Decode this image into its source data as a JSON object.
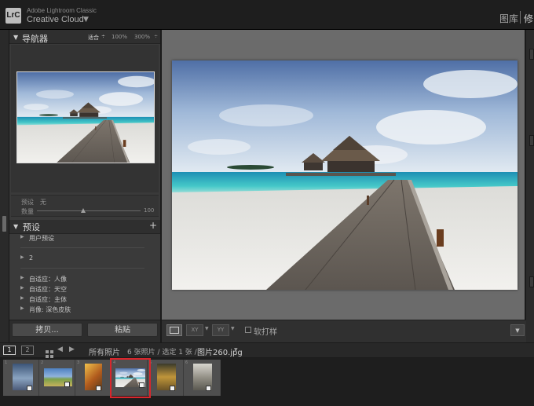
{
  "app": {
    "logo": "LrC",
    "brand_small": "Adobe Lightroom Classic",
    "brand_main": "Creative Cloud",
    "brand_arrow": "▼",
    "modules": [
      "图库",
      "|",
      "修"
    ]
  },
  "navigator": {
    "title": "导航器",
    "fit_label": "适合",
    "fit_arrow": "÷",
    "zoom_100": "100%",
    "zoom_300": "300%",
    "zoom_arrow": "÷"
  },
  "preset_info": {
    "preset_label": "预设",
    "preset_value": "无",
    "amount_label": "数量",
    "amount_value": "100",
    "amount_fraction": 0.45
  },
  "presets": {
    "title": "预设",
    "add": "+",
    "items": [
      {
        "label": "用户预设"
      },
      {
        "label": "2"
      },
      {
        "label": "自适应：人像"
      },
      {
        "label": "自适应：天空"
      },
      {
        "label": "自适应：主体"
      },
      {
        "label": "肖像: 深色皮肤"
      }
    ]
  },
  "buttons": {
    "copy": "拷贝...",
    "paste": "粘贴"
  },
  "toolbar": {
    "compare": "XY",
    "survey": "YY",
    "soft_proof": "软打样"
  },
  "filmstrip": {
    "view_1": "1",
    "view_2": "2",
    "all_photos": "所有照片",
    "count_text": "6 张照片 / 选定 1 张 /",
    "filename": "图片260.jpg",
    "filename_arrow": "▼",
    "selected_index": 3,
    "cells": [
      {
        "num": "1"
      },
      {
        "num": "2"
      },
      {
        "num": "3"
      },
      {
        "num": "4"
      },
      {
        "num": "5"
      },
      {
        "num": "6"
      }
    ]
  },
  "colors": {
    "accent_selected": "#d9262c",
    "sky": "#9db6d8",
    "sea": "#2fb3b8",
    "sand": "#e9e7e2"
  }
}
